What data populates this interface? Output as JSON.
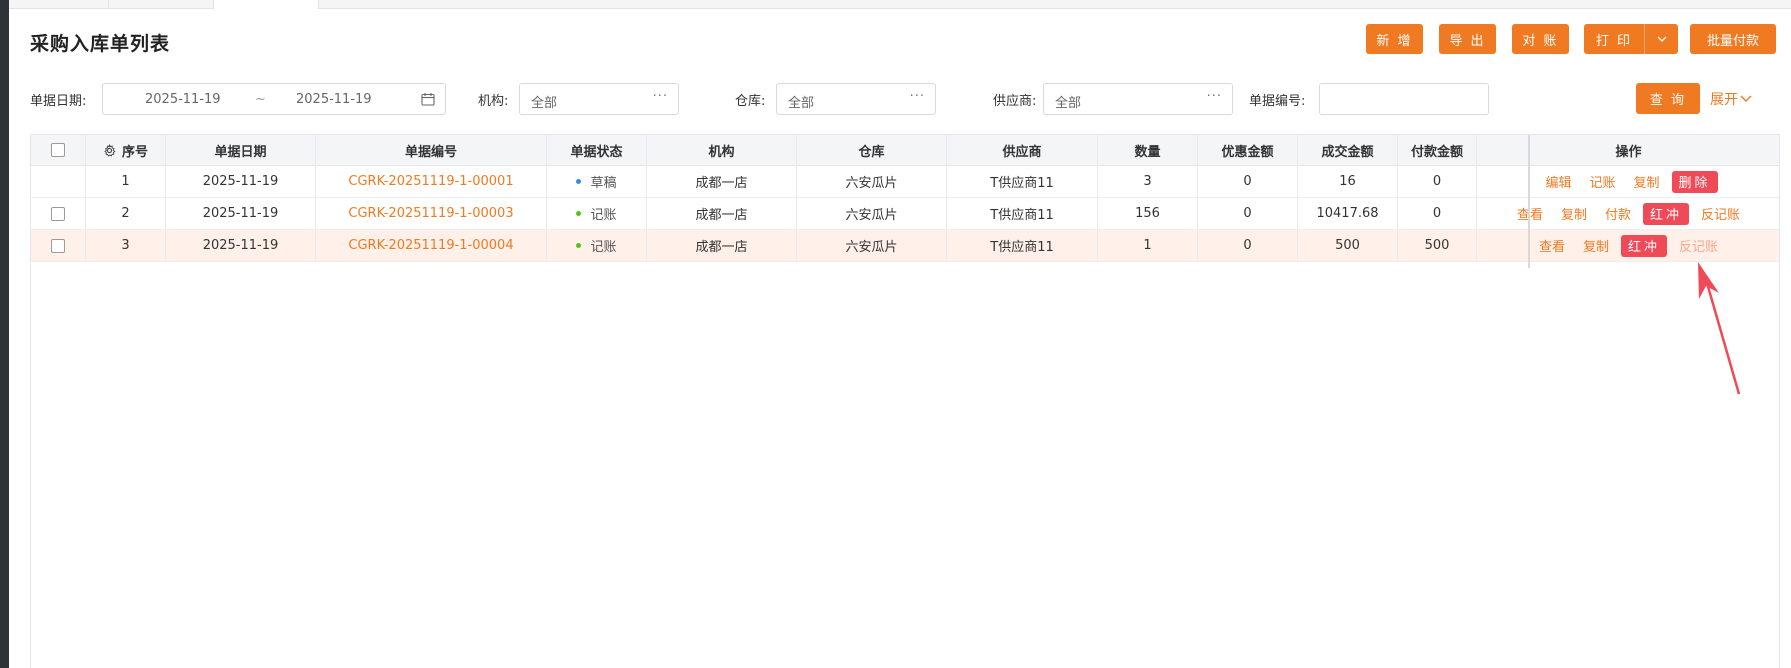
{
  "page_title": "采购入库单列表",
  "toolbar": {
    "add": "新 增",
    "export": "导 出",
    "reconcile": "对 账",
    "print": "打 印",
    "batch_pay": "批量付款"
  },
  "filters": {
    "date_label": "单据日期:",
    "date_start": "2025-11-19",
    "date_sep": "~",
    "date_end": "2025-11-19",
    "org_label": "机构:",
    "org_value": "全部",
    "warehouse_label": "仓库:",
    "warehouse_value": "全部",
    "supplier_label": "供应商:",
    "supplier_value": "全部",
    "docno_label": "单据编号:",
    "docno_value": "",
    "dots": "···",
    "query": "查 询",
    "expand": "展开"
  },
  "table": {
    "headers": {
      "seq": "序号",
      "date": "单据日期",
      "docno": "单据编号",
      "status": "单据状态",
      "org": "机构",
      "warehouse": "仓库",
      "supplier": "供应商",
      "qty": "数量",
      "discount": "优惠金额",
      "deal": "成交金额",
      "paid": "付款金额",
      "ops": "操作"
    },
    "rows": [
      {
        "seq": "1",
        "date": "2025-11-19",
        "docno": "CGRK-20251119-1-00001",
        "status": "草稿",
        "status_color": "#2f8cf0",
        "org": "成都一店",
        "warehouse": "六安瓜片",
        "supplier": "T供应商11",
        "qty": "3",
        "discount": "0",
        "deal": "16",
        "paid": "0",
        "actions": [
          "编辑",
          "记账",
          "复制"
        ],
        "action_button": "删除"
      },
      {
        "seq": "2",
        "date": "2025-11-19",
        "docno": "CGRK-20251119-1-00003",
        "status": "记账",
        "status_color": "#52c41a",
        "org": "成都一店",
        "warehouse": "六安瓜片",
        "supplier": "T供应商11",
        "qty": "156",
        "discount": "0",
        "deal": "10417.68",
        "paid": "0",
        "actions": [
          "查看",
          "复制",
          "付款"
        ],
        "action_button": "红冲",
        "action_after": "反记账"
      },
      {
        "seq": "3",
        "date": "2025-11-19",
        "docno": "CGRK-20251119-1-00004",
        "status": "记账",
        "status_color": "#52c41a",
        "org": "成都一店",
        "warehouse": "六安瓜片",
        "supplier": "T供应商11",
        "qty": "1",
        "discount": "0",
        "deal": "500",
        "paid": "500",
        "actions": [
          "查看",
          "复制"
        ],
        "action_button": "红冲",
        "action_after": "反记账"
      }
    ]
  },
  "colors": {
    "accent": "#f07a22",
    "danger": "#ef4a58",
    "highlight_row": "#fff0e9",
    "annotation_arrow": "#ef4a58"
  }
}
